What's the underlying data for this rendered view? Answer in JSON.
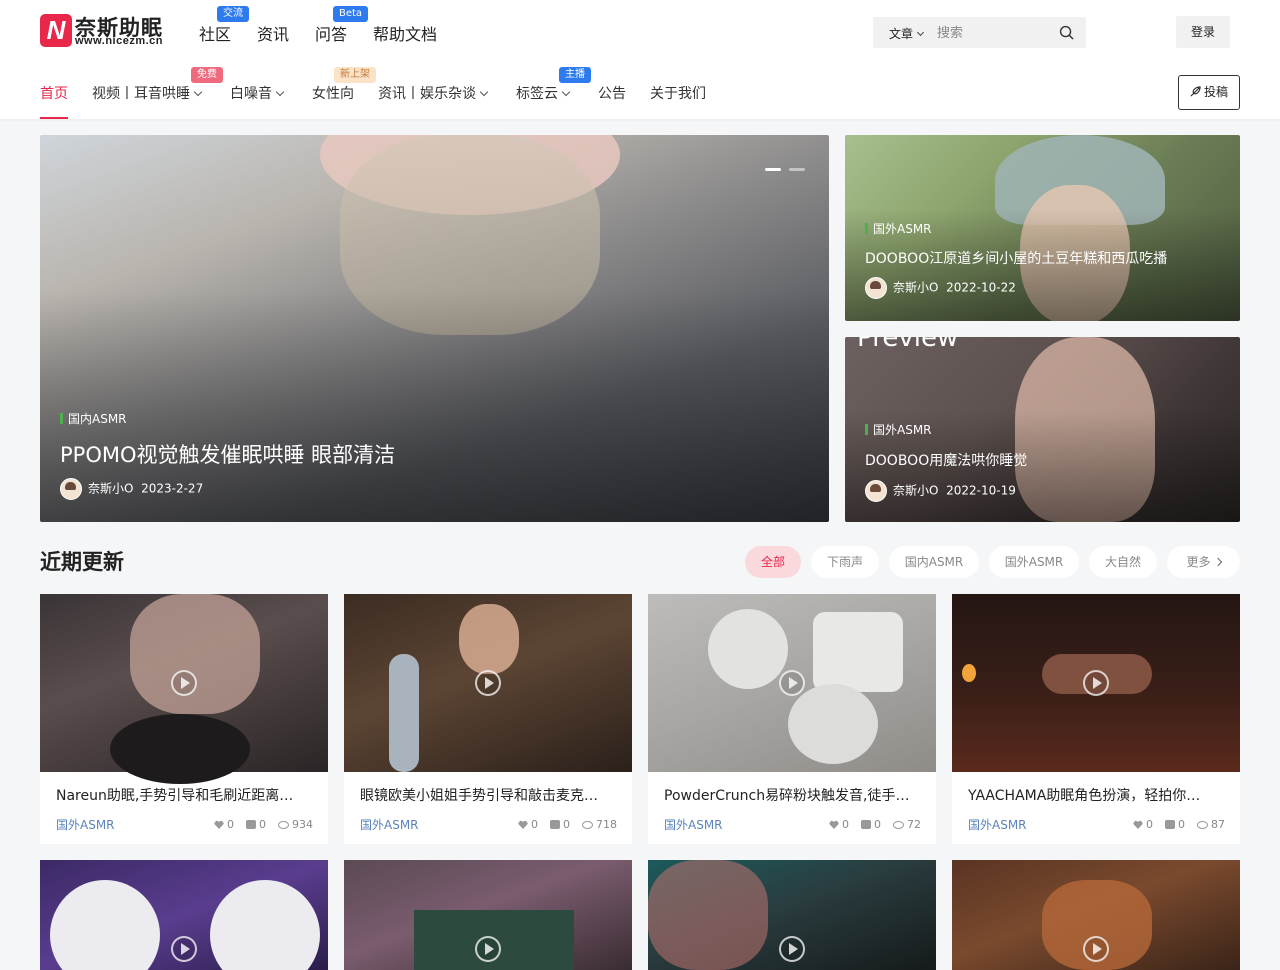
{
  "brand": {
    "mark": "N",
    "name_cn": "奈斯助眠",
    "url": "www.nicezm.cn",
    "accent": "#e8274a"
  },
  "top_nav": [
    {
      "label": "社区",
      "badge": "交流"
    },
    {
      "label": "资讯",
      "badge": ""
    },
    {
      "label": "问答",
      "badge": "Beta"
    },
    {
      "label": "帮助文档",
      "badge": ""
    }
  ],
  "search": {
    "type": "文章",
    "placeholder": "搜索"
  },
  "login_label": "登录",
  "main_nav": [
    {
      "label": "首页",
      "badge": ""
    },
    {
      "label": "视频丨耳音哄睡",
      "badge": "免费"
    },
    {
      "label": "白噪音",
      "badge": ""
    },
    {
      "label": "女性向",
      "badge": "新上架"
    },
    {
      "label": "资讯丨娱乐杂谈",
      "badge": ""
    },
    {
      "label": "标签云",
      "badge": "主播"
    },
    {
      "label": "公告",
      "badge": ""
    },
    {
      "label": "关于我们",
      "badge": ""
    }
  ],
  "submit_label": "投稿",
  "hero": {
    "main": {
      "category": "国内ASMR",
      "title": "PPOMO视觉触发催眠哄睡 眼部清洁",
      "author": "奈斯小O",
      "date": "2023-2-27"
    },
    "side": [
      {
        "category": "国外ASMR",
        "title": "DOOBOO江原道乡间小屋的土豆年糕和西瓜吃播",
        "author": "奈斯小O",
        "date": "2022-10-22"
      },
      {
        "category": "国外ASMR",
        "title": "DOOBOO用魔法哄你睡觉",
        "author": "奈斯小O",
        "date": "2022-10-19",
        "overlay_text": "Preview"
      }
    ]
  },
  "recent": {
    "title": "近期更新",
    "filters": [
      "全部",
      "下雨声",
      "国内ASMR",
      "国外ASMR",
      "大自然",
      "更多"
    ],
    "cards": [
      {
        "title": "Nareun助眠,手势引导和毛刷近距离…",
        "category": "国外ASMR",
        "likes": "0",
        "comments": "0",
        "views": "934"
      },
      {
        "title": "眼镜欧美小姐姐手势引导和敲击麦克…",
        "category": "国外ASMR",
        "likes": "0",
        "comments": "0",
        "views": "718"
      },
      {
        "title": "PowderCrunch易碎粉块触发音,徒手…",
        "category": "国外ASMR",
        "likes": "0",
        "comments": "0",
        "views": "72"
      },
      {
        "title": "YAACHAMA助眠角色扮演，轻拍你…",
        "category": "国外ASMR",
        "likes": "0",
        "comments": "0",
        "views": "87"
      }
    ]
  }
}
